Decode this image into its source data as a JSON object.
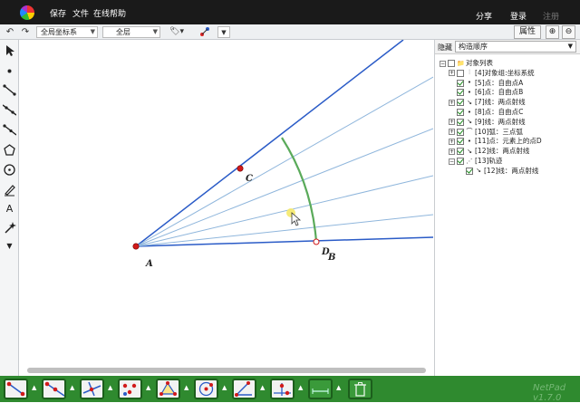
{
  "menubar": {
    "items": [
      "保存",
      "文件",
      "在线帮助"
    ],
    "share": "分享",
    "login": "登录",
    "register": "注册"
  },
  "toolbar": {
    "undo_icon": "undo-icon",
    "redo_icon": "redo-icon",
    "coord_select": "全局坐标系",
    "layer_select": "全层",
    "attr_button": "属性"
  },
  "canvas": {
    "labels": {
      "A": "A",
      "B": "B",
      "C": "C",
      "D": "D"
    },
    "colors": {
      "ray": "#2a5bc7",
      "light_ray": "#8fb6dc",
      "arc": "#5aaa5a",
      "point": "#d11a1a"
    }
  },
  "panel": {
    "hide_label": "隐藏",
    "sort_select": "构造顺序",
    "tree": [
      {
        "label": "对象列表",
        "icon": "folder-icon",
        "checked": false,
        "expand": "−",
        "indent": 0
      },
      {
        "label": "[4]对象组:坐标系统",
        "icon": "group-icon",
        "checked": false,
        "expand": "+",
        "indent": 1
      },
      {
        "label": "[5]点：自由点A",
        "icon": "point-icon",
        "checked": true,
        "expand": "",
        "indent": 1
      },
      {
        "label": "[6]点：自由点B",
        "icon": "point-icon",
        "checked": true,
        "expand": "",
        "indent": 1
      },
      {
        "label": "[7]线：两点射线",
        "icon": "ray-icon",
        "checked": true,
        "expand": "+",
        "indent": 1
      },
      {
        "label": "[8]点：自由点C",
        "icon": "point-icon",
        "checked": true,
        "expand": "",
        "indent": 1
      },
      {
        "label": "[9]线：两点射线",
        "icon": "ray-icon",
        "checked": true,
        "expand": "+",
        "indent": 1
      },
      {
        "label": "[10]弧：三点弧",
        "icon": "arc-icon",
        "checked": true,
        "expand": "+",
        "indent": 1
      },
      {
        "label": "[11]点：元素上的点D",
        "icon": "point-icon",
        "checked": true,
        "expand": "+",
        "indent": 1
      },
      {
        "label": "[12]线：两点射线",
        "icon": "ray-icon",
        "checked": true,
        "expand": "+",
        "indent": 1
      },
      {
        "label": "[13]轨迹",
        "icon": "locus-icon",
        "checked": true,
        "expand": "−",
        "indent": 1
      },
      {
        "label": "[12]线：两点射线",
        "icon": "ray-icon",
        "checked": true,
        "expand": "",
        "indent": 2
      }
    ]
  },
  "brand": "NetPad v1.7.0"
}
